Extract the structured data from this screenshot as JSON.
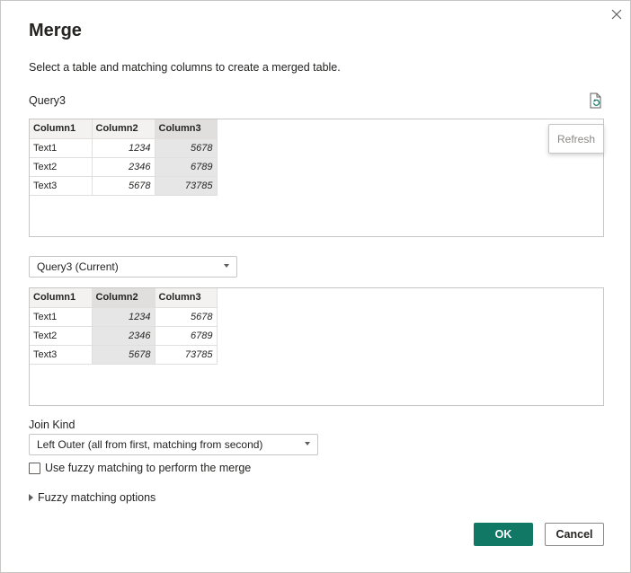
{
  "dialog": {
    "title": "Merge",
    "description": "Select a table and matching columns to create a merged table.",
    "close_icon": "close-icon"
  },
  "top": {
    "query_label": "Query3",
    "refresh_icon": "refresh-icon",
    "refresh_tooltip": "Refresh",
    "headers": [
      "Column1",
      "Column2",
      "Column3"
    ],
    "selected_column": "Column3",
    "rows": [
      [
        "Text1",
        "1234",
        "5678"
      ],
      [
        "Text2",
        "2346",
        "6789"
      ],
      [
        "Text3",
        "5678",
        "73785"
      ]
    ]
  },
  "second": {
    "selected_query": "Query3 (Current)",
    "headers": [
      "Column1",
      "Column2",
      "Column3"
    ],
    "selected_column": "Column2",
    "rows": [
      [
        "Text1",
        "1234",
        "5678"
      ],
      [
        "Text2",
        "2346",
        "6789"
      ],
      [
        "Text3",
        "5678",
        "73785"
      ]
    ]
  },
  "join": {
    "label": "Join Kind",
    "selected": "Left Outer (all from first, matching from second)"
  },
  "fuzzy": {
    "checkbox_label": "Use fuzzy matching to perform the merge",
    "checked": false,
    "options_label": "Fuzzy matching options"
  },
  "buttons": {
    "ok": "OK",
    "cancel": "Cancel"
  },
  "colors": {
    "accent": "#117865",
    "selected_column_bg": "#e6e6e6"
  }
}
